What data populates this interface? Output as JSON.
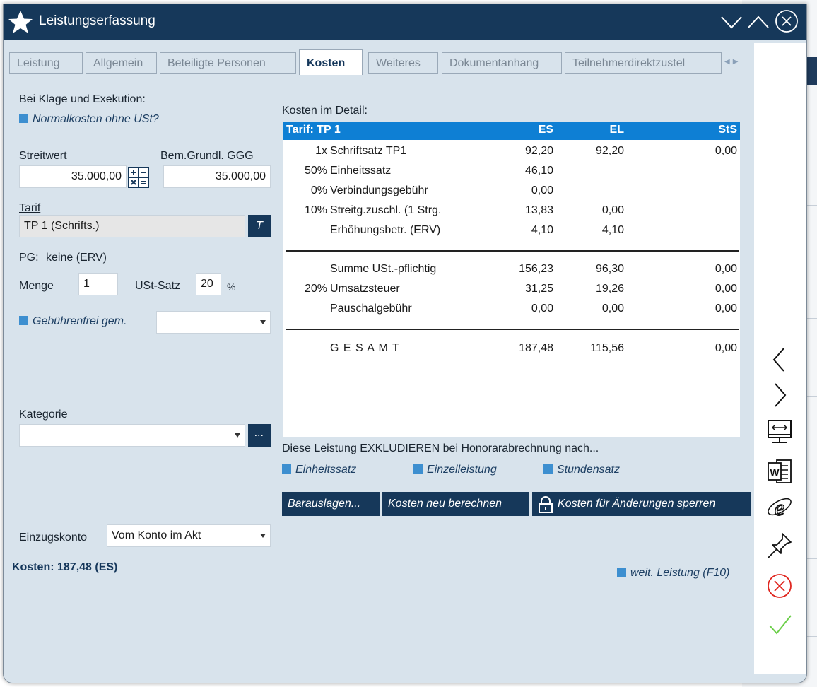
{
  "window": {
    "title": "Leistungserfassung"
  },
  "tabs": [
    {
      "label": "Leistung"
    },
    {
      "label": "Allgemein"
    },
    {
      "label": "Beteiligte Personen"
    },
    {
      "label": "Kosten",
      "active": true
    },
    {
      "label": "Weiteres"
    },
    {
      "label": "Dokumentanhang"
    },
    {
      "label": "Teilnehmerdirektzustel"
    }
  ],
  "left": {
    "klage_label": "Bei Klage und Exekution:",
    "normalkosten_label": "Normalkosten ohne USt?",
    "streitwert_label": "Streitwert",
    "streitwert_value": "35.000,00",
    "bemgrundl_label": "Bem.Grundl. GGG",
    "bemgrundl_value": "35.000,00",
    "tarif_label": "Tarif",
    "tarif_value": "TP 1 (Schrifts.)",
    "tarif_button": "T",
    "pg_label": "PG:",
    "pg_value": "keine (ERV)",
    "menge_label": "Menge",
    "menge_value": "1",
    "ust_label": "USt-Satz",
    "ust_value": "20",
    "ust_unit": "%",
    "gebuehrenfrei_label": "Gebührenfrei gem.",
    "gebuehrenfrei_value": "",
    "kategorie_label": "Kategorie",
    "kategorie_value": "",
    "kategorie_button": "...",
    "einzugskonto_label": "Einzugskonto",
    "einzugskonto_value": "Vom Konto im Akt"
  },
  "costs": {
    "section_label": "Kosten im Detail:",
    "header": {
      "tarif": "Tarif: TP 1",
      "es": "ES",
      "el": "EL",
      "sts": "StS"
    },
    "rows": [
      {
        "pct": "1x",
        "name": "Schriftsatz TP1",
        "es": "92,20",
        "el": "92,20",
        "sts": "0,00"
      },
      {
        "pct": "50%",
        "name": "Einheitssatz",
        "es": "46,10",
        "el": "",
        "sts": ""
      },
      {
        "pct": "0%",
        "name": "Verbindungsgebühr",
        "es": "0,00",
        "el": "",
        "sts": ""
      },
      {
        "pct": "10%",
        "name": "Streitg.zuschl. (1 Strg.",
        "es": "13,83",
        "el": "0,00",
        "sts": ""
      },
      {
        "pct": "",
        "name": "Erhöhungsbetr. (ERV)",
        "es": "4,10",
        "el": "4,10",
        "sts": ""
      }
    ],
    "sums": [
      {
        "pct": "",
        "name": "Summe USt.-pflichtig",
        "es": "156,23",
        "el": "96,30",
        "sts": "0,00"
      },
      {
        "pct": "20%",
        "name": "Umsatzsteuer",
        "es": "31,25",
        "el": "19,26",
        "sts": "0,00"
      },
      {
        "pct": "",
        "name": "Pauschalgebühr",
        "es": "0,00",
        "el": "0,00",
        "sts": "0,00"
      }
    ],
    "total": {
      "name": "G E S A M T",
      "es": "187,48",
      "el": "115,56",
      "sts": "0,00"
    }
  },
  "exclude": {
    "label": "Diese Leistung EXKLUDIEREN bei Honorarabrechnung nach...",
    "options": [
      "Einheitssatz",
      "Einzelleistung",
      "Stundensatz"
    ]
  },
  "buttons": {
    "barauslagen": "Barauslagen...",
    "neu_berechnen": "Kosten neu berechnen",
    "sperren": "Kosten für Änderungen sperren"
  },
  "status": {
    "kosten": "Kosten: 187,48 (ES)",
    "weitere": "weit. Leistung (F10)"
  },
  "sidebar_icons": [
    "chevron-left-icon",
    "chevron-right-icon",
    "screen-resize-icon",
    "word-icon",
    "internet-explorer-icon",
    "pin-icon",
    "cancel-icon",
    "confirm-check-icon"
  ],
  "colors": {
    "titlebar": "#16385a",
    "panel": "#d8e3ec",
    "accent": "#0e7fd4",
    "square": "#3d8fd0",
    "cancel": "#e0261f",
    "confirm": "#6ccf4a"
  }
}
